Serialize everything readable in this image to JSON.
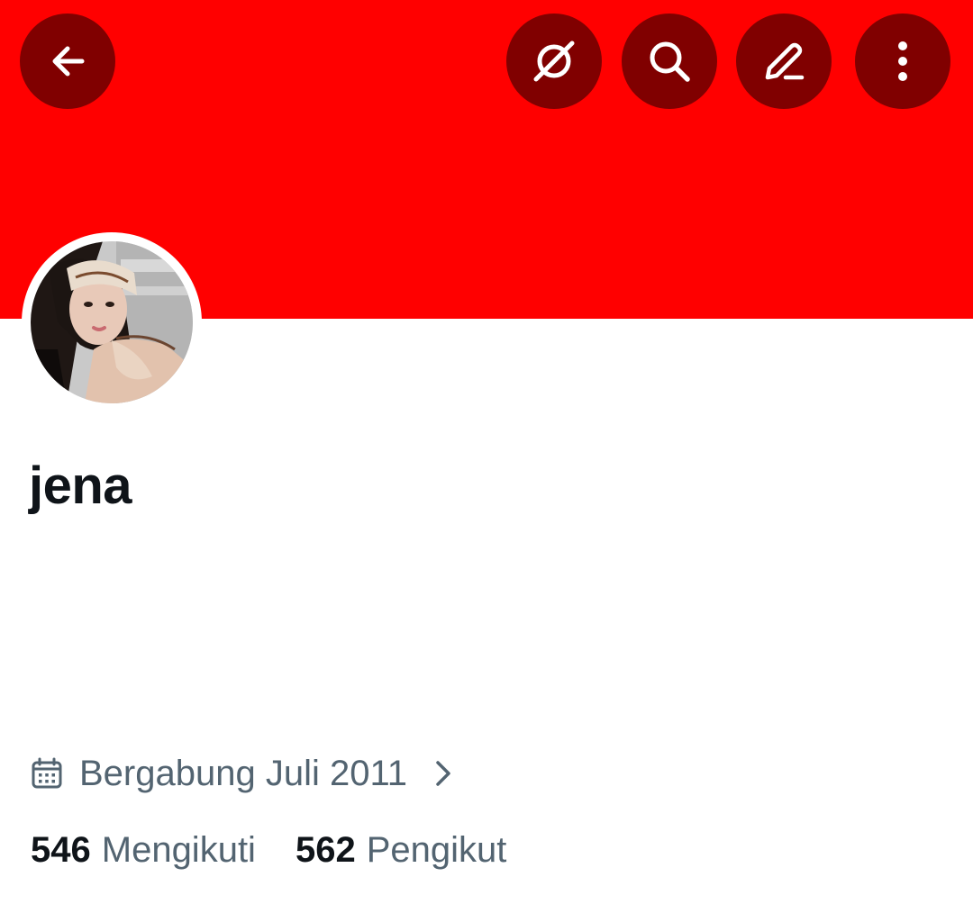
{
  "header": {
    "banner_color": "#ff0000",
    "button_color": "#800000",
    "buttons": {
      "back": "back-arrow-icon",
      "grok": "grok-icon",
      "search": "search-icon",
      "edit": "pencil-icon",
      "more": "more-vertical-icon"
    }
  },
  "profile": {
    "display_name": "jena",
    "avatar": "profile-photo",
    "joined": "Bergabung Juli 2011",
    "following_count": "546",
    "following_label": "Mengikuti",
    "followers_count": "562",
    "followers_label": "Pengikut"
  },
  "colors": {
    "text_primary": "#0f1419",
    "text_secondary": "#536471"
  }
}
